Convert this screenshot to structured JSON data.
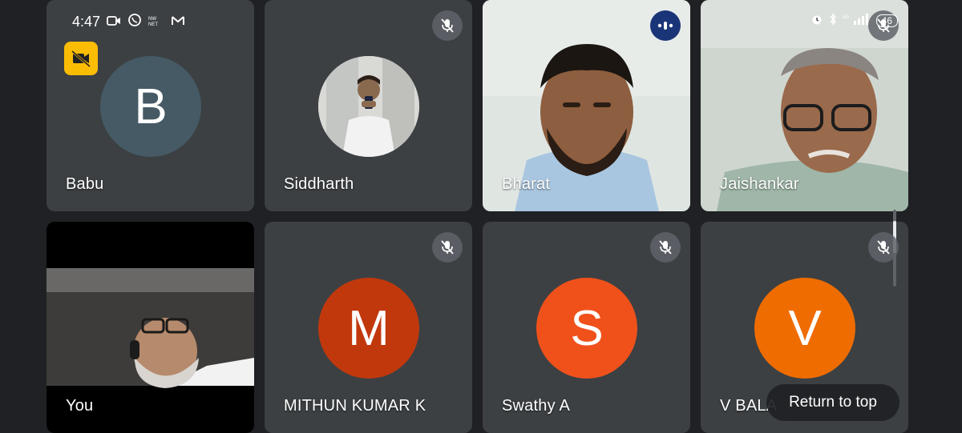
{
  "status_bar": {
    "time": "4:47",
    "icons": [
      "video-icon",
      "whatsapp-icon",
      "nw-net-icon",
      "gmail-icon"
    ],
    "right_icons": [
      "alarm-icon",
      "bluetooth-icon",
      "signal-icon"
    ],
    "battery": "46"
  },
  "participants": [
    {
      "name": "Babu",
      "initial": "B",
      "avatar_color": "#455a64"
    },
    {
      "name": "Siddharth"
    },
    {
      "name": "Bharat"
    },
    {
      "name": "Jaishankar"
    },
    {
      "name": "You"
    },
    {
      "name": "MITHUN KUMAR K",
      "initial": "M",
      "avatar_color": "#c1380d"
    },
    {
      "name": "Swathy A",
      "initial": "S",
      "avatar_color": "#f0511b"
    },
    {
      "name": "V BALA",
      "initial": "V",
      "avatar_color": "#ef6c00"
    }
  ],
  "return_to_top": "Return to top",
  "colors": {
    "background": "#202124",
    "tile": "#3c4043",
    "camera_off_badge": "#fbbc04",
    "speaking_border": "#8ab4f8"
  }
}
